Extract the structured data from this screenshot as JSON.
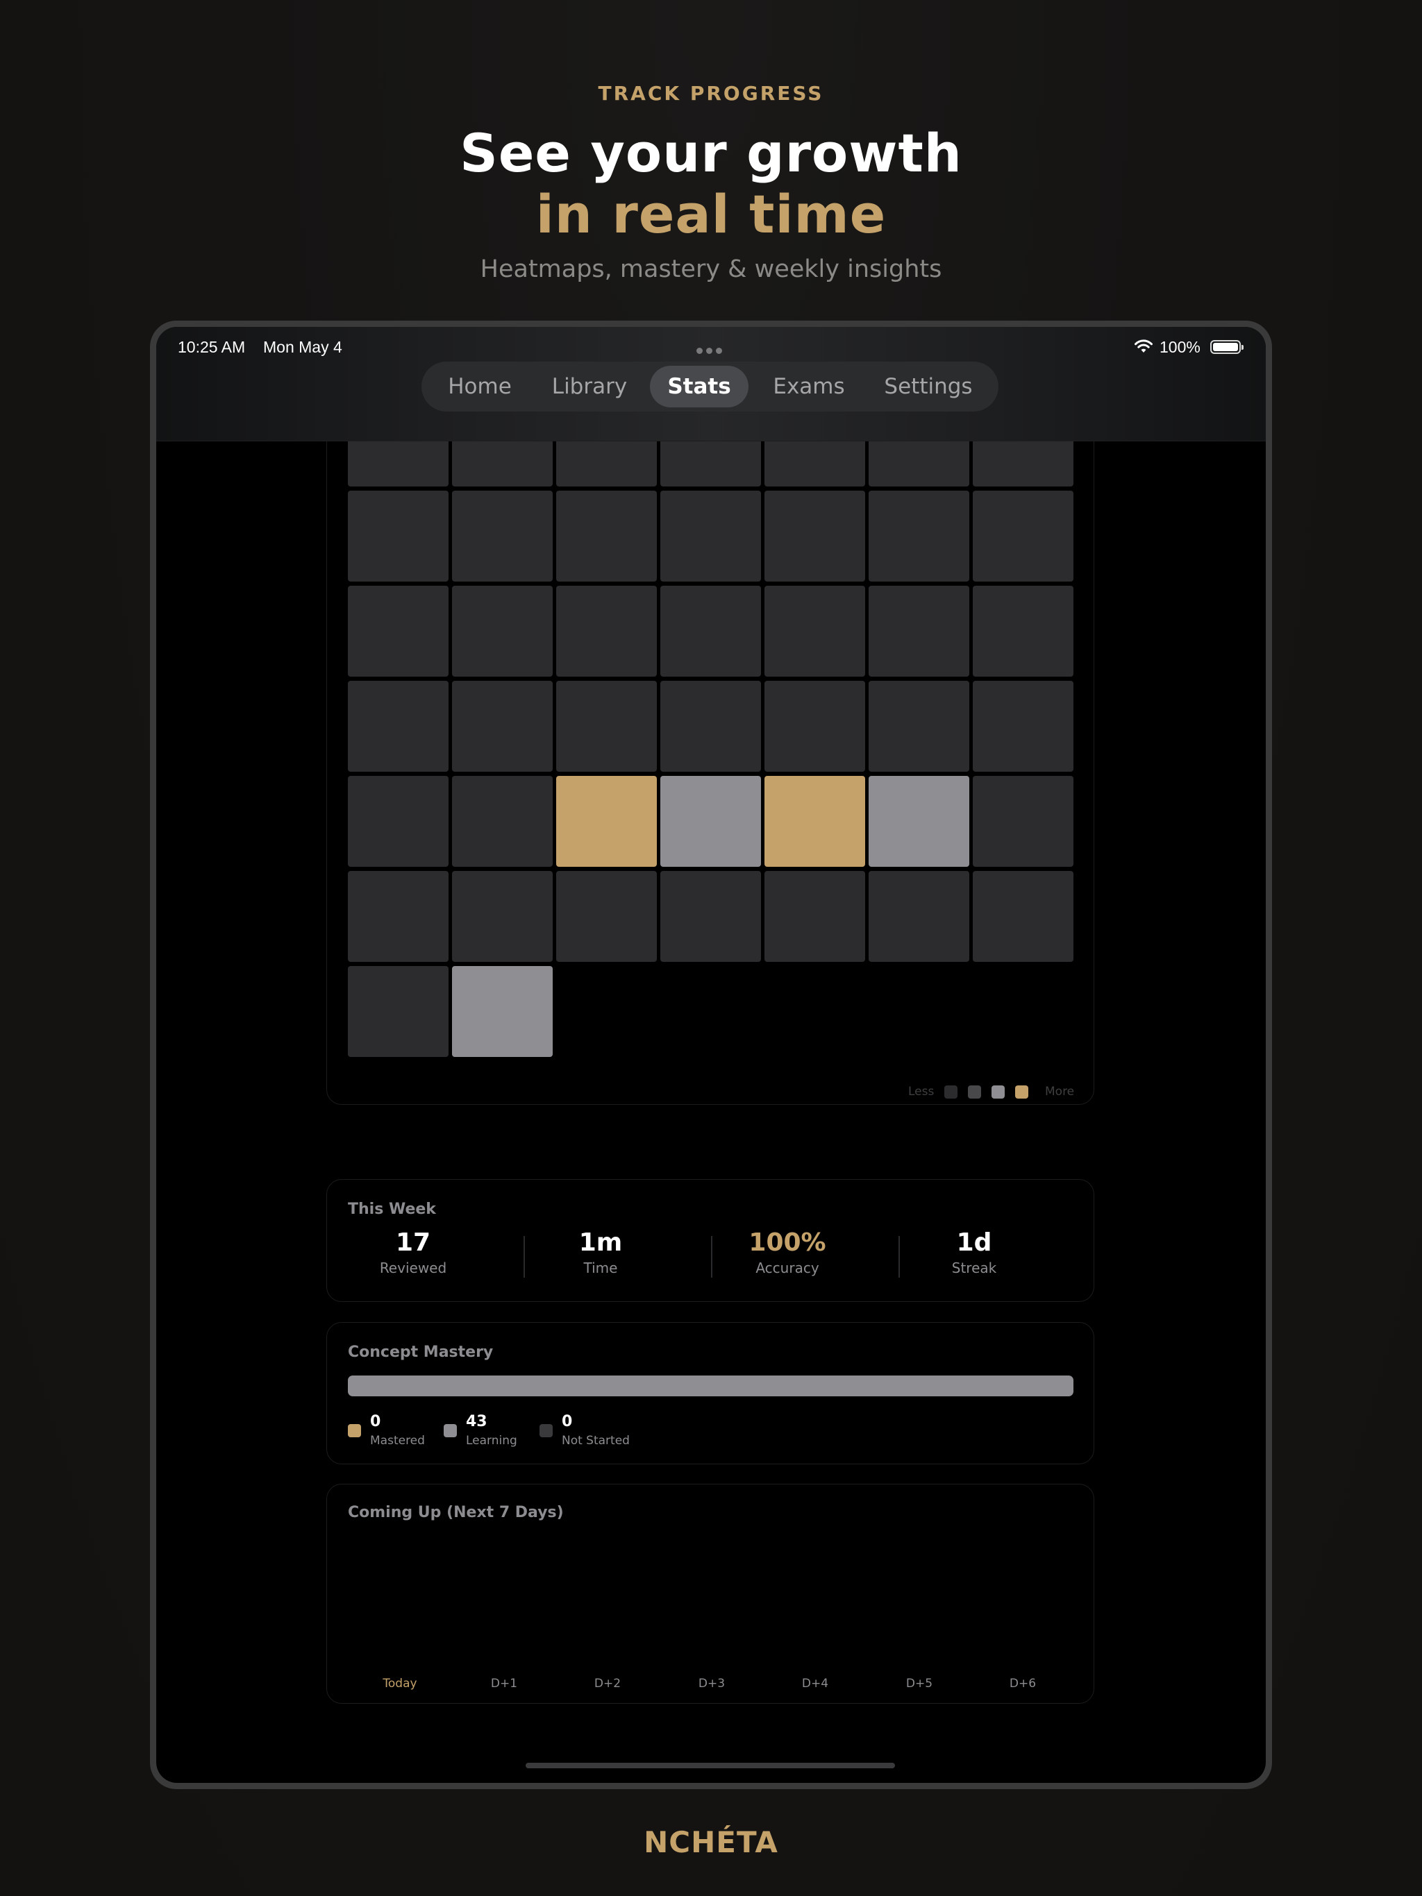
{
  "hero": {
    "eyebrow": "TRACK PROGRESS",
    "line1": "See your growth",
    "line2": "in real time",
    "subtitle": "Heatmaps, mastery & weekly insights"
  },
  "brand": "NCHÉTA",
  "status_bar": {
    "time": "10:25 AM",
    "date": "Mon May 4",
    "battery": "100%"
  },
  "tabs": [
    "Home",
    "Library",
    "Stats",
    "Exams",
    "Settings"
  ],
  "active_tab": "Stats",
  "heatmap": {
    "legend_less": "Less",
    "legend_more": "More",
    "rows": [
      [
        0,
        0,
        0,
        0,
        0,
        0,
        0
      ],
      [
        0,
        0,
        0,
        0,
        0,
        0,
        0
      ],
      [
        0,
        0,
        0,
        0,
        0,
        0,
        0
      ],
      [
        0,
        0,
        0,
        0,
        0,
        0,
        0
      ],
      [
        0,
        0,
        3,
        2,
        3,
        2,
        0
      ],
      [
        0,
        0,
        0,
        0,
        0,
        0,
        0
      ],
      [
        0,
        2
      ]
    ],
    "colors": {
      "0": "#2c2c2e",
      "1": "#48484a",
      "2": "#8e8e93",
      "3": "#c4a26a"
    }
  },
  "this_week": {
    "title": "This Week",
    "stats": [
      {
        "value": "17",
        "label": "Reviewed"
      },
      {
        "value": "1m",
        "label": "Time"
      },
      {
        "value": "100%",
        "label": "Accuracy",
        "accent": true
      },
      {
        "value": "1d",
        "label": "Streak"
      }
    ]
  },
  "mastery": {
    "title": "Concept Mastery",
    "items": [
      {
        "value": "0",
        "label": "Mastered",
        "color": "#c4a26a"
      },
      {
        "value": "43",
        "label": "Learning",
        "color": "#8e8e93"
      },
      {
        "value": "0",
        "label": "Not Started",
        "color": "#3a3a3c"
      }
    ]
  },
  "coming_up": {
    "title": "Coming Up (Next 7 Days)",
    "days": [
      "Today",
      "D+1",
      "D+2",
      "D+3",
      "D+4",
      "D+5",
      "D+6"
    ]
  },
  "accent_color": "#c4a26a"
}
